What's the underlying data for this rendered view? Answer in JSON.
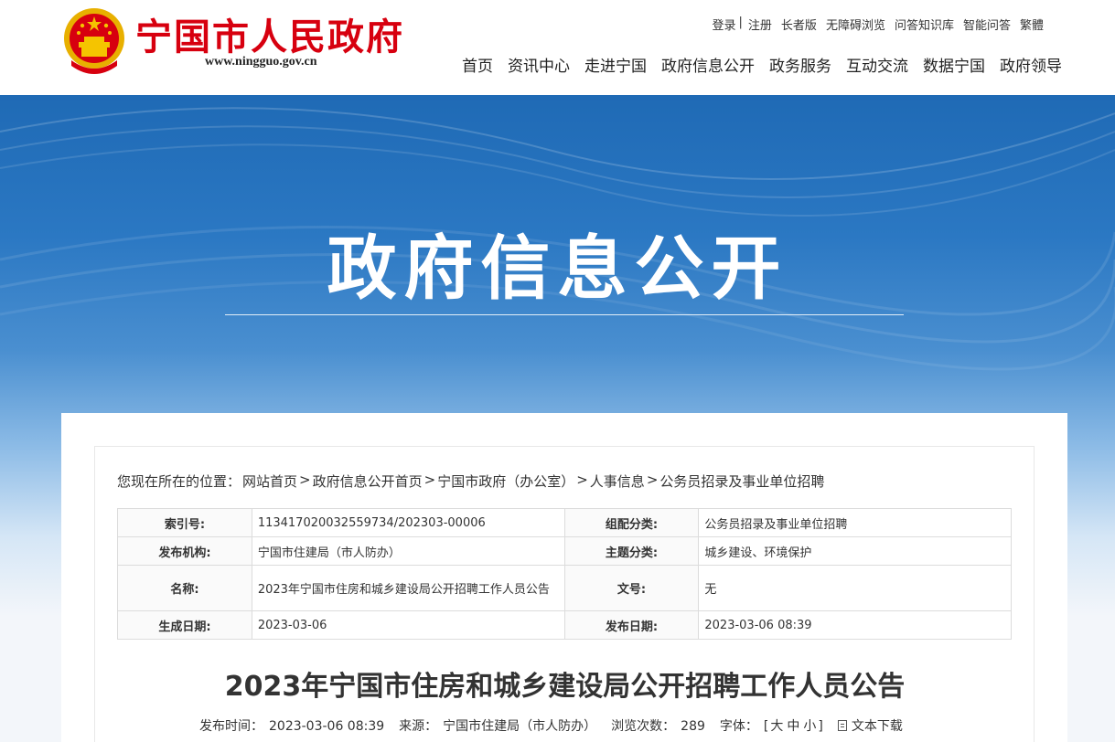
{
  "header": {
    "site_title": "宁国市人民政府",
    "site_url": "www.ningguo.gov.cn",
    "top_links": [
      "登录",
      "注册",
      "长者版",
      "无障碍浏览",
      "问答知识库",
      "智能问答",
      "繁體"
    ],
    "top_separator": "|",
    "nav": [
      "首页",
      "资讯中心",
      "走进宁国",
      "政府信息公开",
      "政务服务",
      "互动交流",
      "数据宁国",
      "政府领导"
    ]
  },
  "banner": {
    "title": "政府信息公开"
  },
  "breadcrumb": {
    "prefix": "您现在所在的位置：",
    "items": [
      "网站首页",
      "政府信息公开首页",
      "宁国市政府（办公室）",
      "人事信息",
      "公务员招录及事业单位招聘"
    ]
  },
  "meta_table": {
    "rows": [
      {
        "k1": "索引号:",
        "v1": "11341702003255973​4/202303-00006",
        "k2": "组配分类:",
        "v2": "公务员招录及事业单位招聘"
      },
      {
        "k1": "发布机构:",
        "v1": "宁国市住建局（市人防办）",
        "k2": "主题分类:",
        "v2": "城乡建设、环境保护"
      },
      {
        "k1": "名称:",
        "v1": "2023年宁国市住房和城乡建设局公开招聘工作人员公告",
        "k2": "文号:",
        "v2": "无"
      },
      {
        "k1": "生成日期:",
        "v1": "2023-03-06",
        "k2": "发布日期:",
        "v2": "2023-03-06 08:39"
      }
    ]
  },
  "article": {
    "title": "2023年宁国市住房和城乡建设局公开招聘工作人员公告",
    "publish_label": "发布时间：",
    "publish_time": "2023-03-06 08:39",
    "source_label": "来源：",
    "source": "宁国市住建局（市人防办）",
    "views_label": "浏览次数：",
    "views": "289",
    "font_label": "字体：",
    "font_open": "[",
    "font_large": "大",
    "font_medium": "中",
    "font_small": "小",
    "font_close": "]",
    "download_label": "文本下载"
  },
  "colors": {
    "brand_red": "#d7000f",
    "banner_blue": "#1f6ab5"
  }
}
